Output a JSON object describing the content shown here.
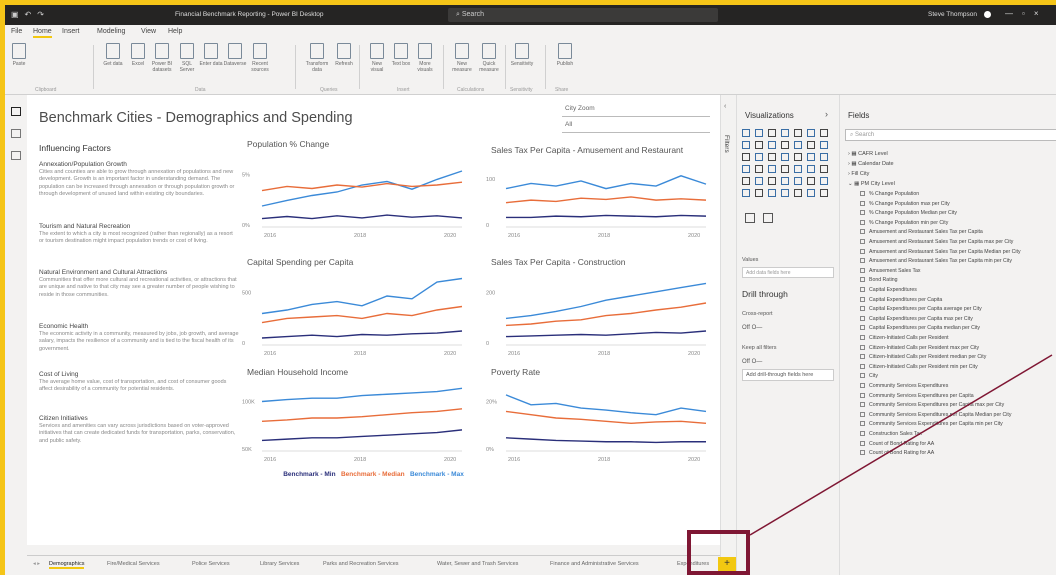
{
  "titlebar": {
    "title": "Financial Benchmark Reporting - Power BI Desktop",
    "search": "Search",
    "user": "Steve Thompson"
  },
  "menu": [
    "File",
    "Home",
    "Insert",
    "Modeling",
    "View",
    "Help"
  ],
  "ribbon": {
    "buttons": [
      "Paste",
      "Get data",
      "Excel",
      "Power BI datasets",
      "SQL Server",
      "Enter data",
      "Dataverse",
      "Recent sources",
      "Transform data",
      "Refresh",
      "New visual",
      "Text box",
      "More visuals",
      "New measure",
      "Quick measure",
      "Sensitivity",
      "Publish"
    ],
    "groups": [
      "Clipboard",
      "Data",
      "Queries",
      "Insert",
      "Calculations",
      "Sensitivity",
      "Share"
    ]
  },
  "report": {
    "title": "Benchmark Cities - Demographics and Spending",
    "slicer1": "City Zoom",
    "slicer2": "All"
  },
  "factors": {
    "title": "Influencing Factors",
    "items": [
      {
        "h": "Annexation/Population Growth",
        "b": "Cities and counties are able to grow through annexation of populations and new development. Growth is an important factor in understanding demand. The population can be increased through annexation or through population growth or through development of unused land within existing city boundaries."
      },
      {
        "h": "Tourism and Natural Recreation",
        "b": "The extent to which a city is most recognized (rather than regionally) as a resort or tourism destination might impact population trends or cost of living."
      },
      {
        "h": "Natural Environment and Cultural Attractions",
        "b": "Communities that offer more cultural and recreational activities, or attractions that are unique and native to that city may see a greater number of people wishing to reside in those communities."
      },
      {
        "h": "Economic Health",
        "b": "The economic activity in a community, measured by jobs, job growth, and average salary, impacts the resilience of a community and is tied to the fiscal health of its government."
      },
      {
        "h": "Cost of Living",
        "b": "The average home value, cost of transportation, and cost of consumer goods affect desirability of a community for potential residents."
      },
      {
        "h": "Citizen Initiatives",
        "b": "Services and amenities can vary across jurisdictions based on voter-approved initiatives that can create dedicated funds for transportation, parks, conservation, and public safety."
      }
    ]
  },
  "charts": [
    {
      "title": "Population % Change",
      "yticks": [
        "5%",
        "0%"
      ],
      "xticks": [
        "2016",
        "2018",
        "2020"
      ]
    },
    {
      "title": "Sales Tax Per Capita - Amusement and Restaurant",
      "yticks": [
        "100",
        "0"
      ],
      "xticks": [
        "2016",
        "2018",
        "2020"
      ]
    },
    {
      "title": "Capital Spending per Capita",
      "yticks": [
        "500",
        "0"
      ],
      "xticks": [
        "2016",
        "2018",
        "2020"
      ]
    },
    {
      "title": "Sales Tax Per Capita - Construction",
      "yticks": [
        "200",
        "0"
      ],
      "xticks": [
        "2016",
        "2018",
        "2020"
      ]
    },
    {
      "title": "Median Household Income",
      "yticks": [
        "100K",
        "50K"
      ],
      "xticks": [
        "2016",
        "2018",
        "2020"
      ]
    },
    {
      "title": "Poverty Rate",
      "yticks": [
        "20%",
        "0%"
      ],
      "xticks": [
        "2016",
        "2018",
        "2020"
      ]
    }
  ],
  "legend": {
    "min": "Benchmark - Min",
    "median": "Benchmark - Median",
    "max": "Benchmark - Max"
  },
  "colors": {
    "max": "#3b8ad8",
    "median": "#e86d3a",
    "min": "#2a2f7a",
    "accent": "#f2c811",
    "highlight": "#7f1734"
  },
  "panes": {
    "filters": "Filters",
    "visualizations": "Visualizations",
    "fields": "Fields",
    "search": "Search",
    "values": "Values",
    "values_hint": "Add data fields here",
    "drill": "Drill through",
    "cross": "Cross-report",
    "off1": "Off",
    "keep": "Keep all filters",
    "off2": "Off",
    "add_drill": "Add drill-through fields here"
  },
  "fields": {
    "tables": [
      "CAFR Level",
      "Calendar Date",
      "Fill City",
      "PM City Level"
    ],
    "items": [
      "% Change Population",
      "% Change Population max per City",
      "% Change Population Median per City",
      "% Change Population min per City",
      "Amusement and Restaurant Sales Tax per Capita",
      "Amusement and Restaurant Sales Tax per Capita max per City",
      "Amusement and Restaurant Sales Tax per Capita Median per City",
      "Amusement and Restaurant Sales Tax per Capita min per City",
      "Amusement Sales Tax",
      "Bond Rating",
      "Capital Expenditures",
      "Capital Expenditures per Capita",
      "Capital Expenditures per Capita average per City",
      "Capital Expenditures per Capita max per City",
      "Capital Expenditures per Capita median per City",
      "Citizen-Initiated Calls per Resident",
      "Citizen-Initiated Calls per Resident max per City",
      "Citizen-Initiated Calls per Resident median per City",
      "Citizen-Initiated Calls per Resident min per City",
      "City",
      "Community Services Expenditures",
      "Community Services Expenditures per Capita",
      "Community Services Expenditures per Capita max per City",
      "Community Services Expenditures per Capita Median per City",
      "Community Services Expenditures per Capita min per City",
      "Construction Sales Tax",
      "Count of Bond Rating for AA",
      "Count of Bond Rating for AA"
    ]
  },
  "tabs": [
    "Demographics",
    "Fire/Medical Services",
    "Police Services",
    "Library Services",
    "Parks and Recreation Services",
    "Water, Sewer and Trash Services",
    "Finance and Administrative Services",
    "Expenditures"
  ],
  "add_tab": "+"
}
